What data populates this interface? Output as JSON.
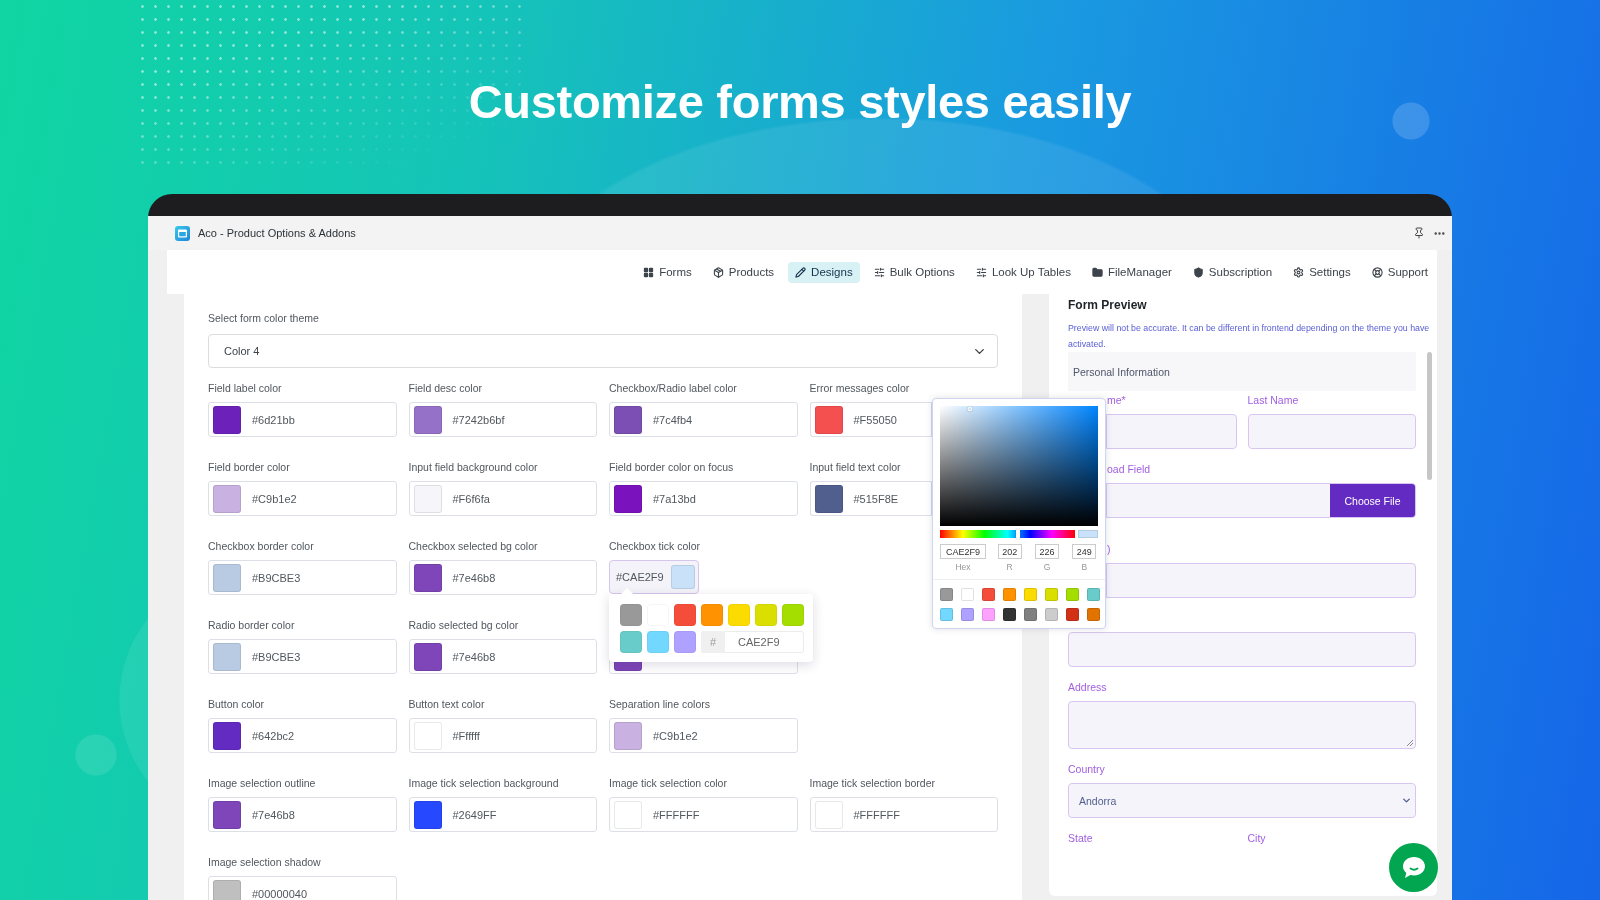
{
  "headline": "Customize forms styles easily",
  "window": {
    "title": "Aco - Product Options & Addons"
  },
  "nav": [
    {
      "label": "Forms",
      "selected": false
    },
    {
      "label": "Products",
      "selected": false
    },
    {
      "label": "Designs",
      "selected": true
    },
    {
      "label": "Bulk Options",
      "selected": false
    },
    {
      "label": "Look Up Tables",
      "selected": false
    },
    {
      "label": "FileManager",
      "selected": false
    },
    {
      "label": "Subscription",
      "selected": false
    },
    {
      "label": "Settings",
      "selected": false
    },
    {
      "label": "Support",
      "selected": false
    }
  ],
  "color_settings": {
    "theme": {
      "label": "Select form color theme",
      "value": "Color 4"
    },
    "rows": [
      [
        {
          "kind": "swatch",
          "label": "Field label color",
          "value": "#6d21bb",
          "color": "#6d21bb"
        },
        {
          "kind": "swatch",
          "label": "Field desc color",
          "value": "#7242b6bf",
          "color": "#9571c8"
        },
        {
          "kind": "swatch",
          "label": "Checkbox/Radio label color",
          "value": "#7c4fb4",
          "color": "#7c4fb4"
        },
        {
          "kind": "clipped",
          "label": "Error messages color",
          "value": "#F55050",
          "color": "#f55050"
        }
      ],
      [
        {
          "kind": "swatch",
          "label": "Field border color",
          "value": "#C9b1e2",
          "color": "#c9b1e2"
        },
        {
          "kind": "swatch",
          "label": "Input field background color",
          "value": "#F6f6fa",
          "color": "#f6f6fa"
        },
        {
          "kind": "swatch",
          "label": "Field border color on focus",
          "value": "#7a13bd",
          "color": "#7a13bd"
        },
        {
          "kind": "clipped",
          "label": "Input field text color",
          "value": "#515F8E",
          "color": "#515f8e"
        }
      ],
      [
        {
          "kind": "swatch",
          "label": "Checkbox border color",
          "value": "#B9CBE3",
          "color": "#b9cbe3"
        },
        {
          "kind": "swatch",
          "label": "Checkbox selected bg color",
          "value": "#7e46b8",
          "color": "#7e46b8"
        },
        {
          "kind": "open",
          "label": "Checkbox tick color",
          "value": "#CAE2F9",
          "color": "#cae2f9",
          "palette": {
            "swatches": [
              {
                "color": "#999999"
              },
              {
                "color": "#ffffff"
              },
              {
                "color": "#f44e3b"
              },
              {
                "color": "#fe9200"
              },
              {
                "color": "#fcdc00"
              },
              {
                "color": "#dbdf00"
              },
              {
                "color": "#a4dd00"
              },
              {
                "color": "#68ccca"
              },
              {
                "color": "#73d8ff"
              },
              {
                "color": "#aea1ff"
              }
            ],
            "prefix": "#",
            "hex": "CAE2F9"
          }
        }
      ],
      [
        {
          "kind": "swatch",
          "label": "Radio border color",
          "value": "#B9CBE3",
          "color": "#b9cbe3"
        },
        {
          "kind": "swatch",
          "label": "Radio selected bg color",
          "value": "#7e46b8",
          "color": "#7e46b8"
        },
        {
          "kind": "covered",
          "color": "#7e46b8"
        }
      ],
      [
        {
          "kind": "swatch",
          "label": "Button color",
          "value": "#642bc2",
          "color": "#642bc2"
        },
        {
          "kind": "swatch",
          "label": "Button text color",
          "value": "#Ffffff",
          "color": "#ffffff"
        },
        {
          "kind": "swatch",
          "label": "Separation line colors",
          "value": "#C9b1e2",
          "color": "#c9b1e2"
        }
      ],
      [
        {
          "kind": "swatch",
          "label": "Image selection outline",
          "value": "#7e46b8",
          "color": "#7e46b8"
        },
        {
          "kind": "swatch",
          "label": "Image tick selection background",
          "value": "#2649FF",
          "color": "#2649ff"
        },
        {
          "kind": "swatch",
          "label": "Image tick selection color",
          "value": "#FFFFFF",
          "color": "#ffffff"
        },
        {
          "kind": "swatch",
          "label": "Image tick selection border",
          "value": "#FFFFFF",
          "color": "#ffffff"
        }
      ],
      [
        {
          "kind": "swatch",
          "label": "Image selection shadow",
          "value": "#00000040",
          "color": "#bfbfbf"
        }
      ]
    ]
  },
  "color_picker": {
    "hue_slider": {
      "level": 0.58
    },
    "hex": "CAE2F9",
    "r": "202",
    "g": "226",
    "b": "249",
    "captions": [
      "Hex",
      "R",
      "G",
      "B"
    ],
    "swatches": [
      {
        "color": "#999999"
      },
      {
        "color": "#ffffff"
      },
      {
        "color": "#f44e3b"
      },
      {
        "color": "#fe9200"
      },
      {
        "color": "#fcdc00"
      },
      {
        "color": "#dbdf00"
      },
      {
        "color": "#a4dd00"
      },
      {
        "color": "#68ccca"
      },
      {
        "color": "#73d8ff"
      },
      {
        "color": "#aea1ff"
      },
      {
        "color": "#fda1ff"
      },
      {
        "color": "#333333"
      },
      {
        "color": "#808080"
      },
      {
        "color": "#cccccc"
      },
      {
        "color": "#d33115"
      },
      {
        "color": "#e27300"
      }
    ]
  },
  "preview": {
    "title": "Form Preview",
    "note": "Preview will not be accurate. It can be different in frontend depending on the theme you have activated.",
    "section": "Personal Information",
    "rows": [
      {
        "kind": "pair",
        "fields": [
          {
            "label": "me*",
            "cut": true
          },
          {
            "label": "Last Name",
            "cut": false
          }
        ]
      },
      {
        "kind": "file",
        "label": "oad Field",
        "cut": true,
        "button": "Choose File"
      },
      {
        "kind": "text",
        "label": ")",
        "cut": true
      },
      {
        "kind": "text"
      },
      {
        "kind": "textarea",
        "label": "Address"
      },
      {
        "kind": "select",
        "label": "Country",
        "value": "Andorra"
      },
      {
        "kind": "labels",
        "fields": [
          {
            "label": "State"
          },
          {
            "label": "City"
          }
        ]
      }
    ]
  }
}
